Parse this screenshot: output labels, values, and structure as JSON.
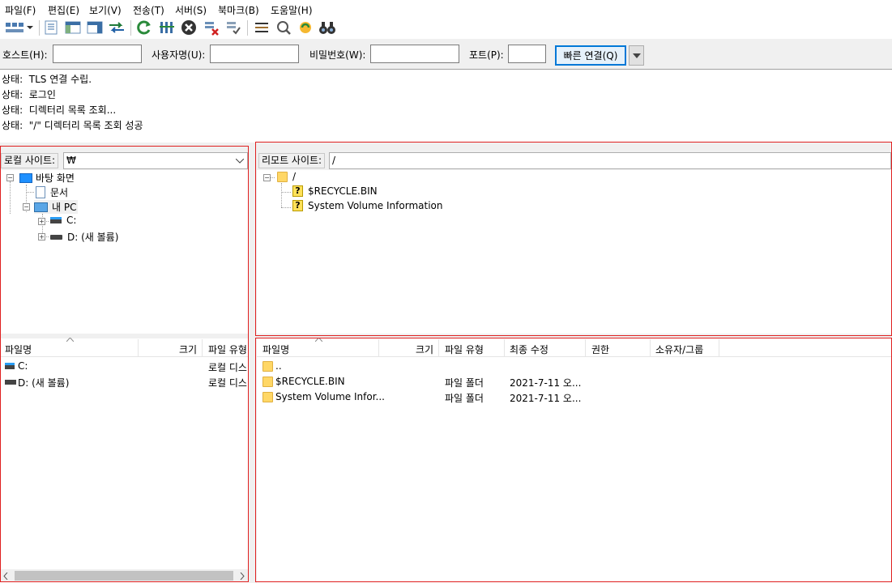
{
  "menu": [
    "파일(F)",
    "편집(E)",
    "보기(V)",
    "전송(T)",
    "서버(S)",
    "북마크(B)",
    "도움말(H)"
  ],
  "toolbar": {
    "icons": [
      "site-manager-icon",
      "dropdown-arrow-icon",
      "toggle-log-icon",
      "toggle-local-tree-icon",
      "toggle-remote-tree-icon",
      "toggle-queue-icon",
      "refresh-icon",
      "process-queue-icon",
      "cancel-icon",
      "disconnect-icon",
      "reconnect-icon",
      "filter-icon",
      "compare-icon",
      "sync-browse-icon",
      "search-icon"
    ]
  },
  "quickconnect": {
    "host_label": "호스트(H):",
    "user_label": "사용자명(U):",
    "pass_label": "비밀번호(W):",
    "port_label": "포트(P):",
    "host_value": "",
    "user_value": "",
    "pass_value": "",
    "port_value": "",
    "connect_label": "빠른 연결(Q)"
  },
  "log": [
    {
      "prefix": "상태:",
      "text": "TLS 연결 수립."
    },
    {
      "prefix": "상태:",
      "text": "로그인"
    },
    {
      "prefix": "상태:",
      "text": "디렉터리 목록 조회..."
    },
    {
      "prefix": "상태:",
      "text": "\"/\" 디렉터리 목록 조회 성공"
    }
  ],
  "local": {
    "site_label": "로컬 사이트:",
    "path": "₩",
    "tree": [
      {
        "label": "바탕 화면",
        "icon": "desktop-icon"
      },
      {
        "label": "문서",
        "icon": "document-icon"
      },
      {
        "label": "내 PC",
        "icon": "computer-icon"
      },
      {
        "label": "C:",
        "icon": "windows-drive-icon"
      },
      {
        "label": "D: (새 볼륨)",
        "icon": "drive-icon"
      }
    ],
    "columns": [
      "파일명",
      "크기",
      "파일 유형"
    ],
    "files": [
      {
        "name": "C:",
        "size": "",
        "type": "로컬 디스",
        "icon": "windows-drive-icon"
      },
      {
        "name": "D: (새 볼륨)",
        "size": "",
        "type": "로컬 디스",
        "icon": "drive-icon"
      }
    ]
  },
  "remote": {
    "site_label": "리모트 사이트:",
    "path": "/",
    "tree": [
      {
        "label": "/",
        "icon": "folder-icon"
      },
      {
        "label": "$RECYCLE.BIN",
        "icon": "unknown-folder-icon"
      },
      {
        "label": "System Volume Information",
        "icon": "unknown-folder-icon"
      }
    ],
    "columns": [
      "파일명",
      "크기",
      "파일 유형",
      "최종 수정",
      "권한",
      "소유자/그룹"
    ],
    "files": [
      {
        "name": "..",
        "size": "",
        "type": "",
        "modified": "",
        "perm": "",
        "owner": ""
      },
      {
        "name": "$RECYCLE.BIN",
        "size": "",
        "type": "파일 폴더",
        "modified": "2021-7-11 오...",
        "perm": "",
        "owner": ""
      },
      {
        "name": "System Volume Infor...",
        "size": "",
        "type": "파일 폴더",
        "modified": "2021-7-11 오...",
        "perm": "",
        "owner": ""
      }
    ]
  },
  "colors": {
    "highlight": "#e02020",
    "accent": "#0078d7",
    "folder": "#ffd766"
  }
}
